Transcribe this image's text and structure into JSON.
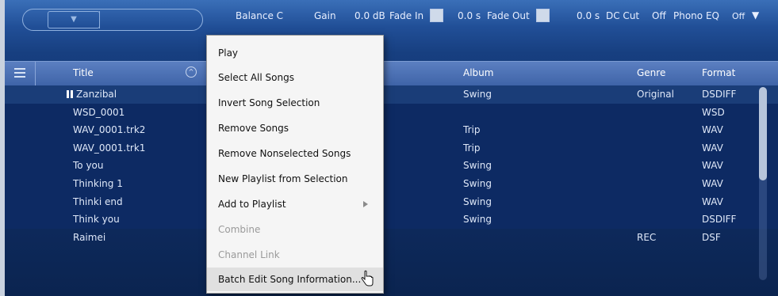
{
  "toolbar": {
    "volume_dropdown": "▼",
    "balance": "Balance C",
    "gain_label": "Gain",
    "gain_value": "0.0 dB",
    "fade_in_label": "Fade In",
    "fade_in_value": "0.0 s",
    "fade_out_label": "Fade Out",
    "fade_out_value": "0.0 s",
    "dc_cut_label": "DC Cut",
    "dc_cut_value": "Off",
    "phono_eq_label": "Phono EQ",
    "phono_eq_value": "Off",
    "phono_eq_arrow": "▼"
  },
  "table": {
    "columns": {
      "title": "Title",
      "album": "Album",
      "genre": "Genre",
      "format": "Format"
    },
    "sort_indicator": "^",
    "rows": [
      {
        "title": "Zanzibal",
        "album": "Swing",
        "genre": "Original",
        "format": "DSDIFF",
        "playing": true
      },
      {
        "title": "WSD_0001",
        "album": "",
        "genre": "",
        "format": "WSD"
      },
      {
        "title": "WAV_0001.trk2",
        "album": "Trip",
        "genre": "",
        "format": "WAV"
      },
      {
        "title": "WAV_0001.trk1",
        "album": "Trip",
        "genre": "",
        "format": "WAV"
      },
      {
        "title": "To you",
        "album": "Swing",
        "genre": "",
        "format": "WAV"
      },
      {
        "title": "Thinking 1",
        "album": "Swing",
        "genre": "",
        "format": "WAV"
      },
      {
        "title": "Thinki end",
        "album": "Swing",
        "genre": "",
        "format": "WAV"
      },
      {
        "title": "Think you",
        "album": "Swing",
        "genre": "",
        "format": "DSDIFF"
      },
      {
        "title": "Raimei",
        "album": "",
        "genre": "REC",
        "format": "DSF"
      }
    ]
  },
  "context_menu": {
    "items": [
      {
        "label": "Play",
        "enabled": true
      },
      {
        "label": "Select All Songs",
        "enabled": true
      },
      {
        "label": "Invert Song Selection",
        "enabled": true
      },
      {
        "label": "Remove Songs",
        "enabled": true
      },
      {
        "label": "Remove Nonselected Songs",
        "enabled": true
      },
      {
        "label": "New Playlist from Selection",
        "enabled": true
      },
      {
        "label": "Add to Playlist",
        "enabled": true,
        "submenu": true
      },
      {
        "label": "Combine",
        "enabled": false
      },
      {
        "label": "Channel Link",
        "enabled": false
      },
      {
        "label": "Batch Edit Song Information...",
        "enabled": true,
        "hovered": true
      }
    ]
  }
}
